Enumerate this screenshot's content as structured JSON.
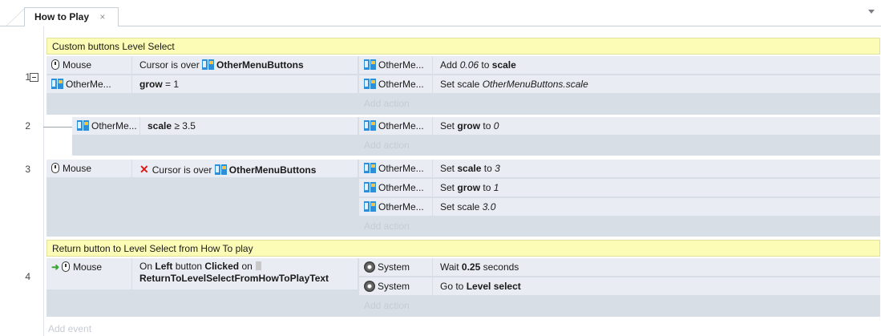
{
  "tab": {
    "title": "How to Play",
    "close": "×"
  },
  "groups": [
    {
      "title": "Custom buttons Level Select"
    },
    {
      "title": "Return button to Level Select from How To play"
    }
  ],
  "events": [
    {
      "number": "1",
      "conditions": [
        {
          "object": "Mouse",
          "text": "Cursor is over",
          "target": "OtherMenuButtons"
        },
        {
          "object": "OtherMe...",
          "param": "grow",
          "text": "= 1"
        }
      ],
      "actions": [
        {
          "object": "OtherMe...",
          "pre": "Add",
          "val": "0.06",
          "mid": "to",
          "param": "scale"
        },
        {
          "object": "OtherMe...",
          "pre": "Set scale",
          "val": "OtherMenuButtons.scale"
        }
      ],
      "add_action": "Add action"
    },
    {
      "number": "2",
      "conditions": [
        {
          "object": "OtherMe...",
          "param": "scale",
          "text": "≥ 3.5"
        }
      ],
      "actions": [
        {
          "object": "OtherMe...",
          "pre": "Set",
          "param": "grow",
          "mid": "to",
          "val": "0"
        }
      ],
      "add_action": "Add action"
    },
    {
      "number": "3",
      "conditions": [
        {
          "object": "Mouse",
          "text": "Cursor is over",
          "target": "OtherMenuButtons"
        }
      ],
      "actions": [
        {
          "object": "OtherMe...",
          "pre": "Set",
          "param": "scale",
          "mid": "to",
          "val": "3"
        },
        {
          "object": "OtherMe...",
          "pre": "Set",
          "param": "grow",
          "mid": "to",
          "val": "1"
        },
        {
          "object": "OtherMe...",
          "pre": "Set scale",
          "val": "3.0"
        }
      ],
      "add_action": "Add action"
    },
    {
      "number": "4",
      "conditions": [
        {
          "object": "Mouse",
          "pre": "On",
          "b1": "Left",
          "mid": "button",
          "b2": "Clicked",
          "post": "on",
          "target": "ReturnToLevelSelectFromHowToPlayText"
        }
      ],
      "actions": [
        {
          "object": "System",
          "pre": "Wait",
          "val": "0.25",
          "post": "seconds"
        },
        {
          "object": "System",
          "pre": "Go to",
          "param": "Level select"
        }
      ],
      "add_action": "Add action"
    }
  ],
  "add_event": "Add event",
  "icons": {
    "mouse": "mouse-icon",
    "sprite": "sprite-icon",
    "system": "gear-icon",
    "invert": "x-icon",
    "trigger": "green-arrow-icon",
    "text_object": "text-object-icon",
    "collapse": "collapse-minus-icon"
  },
  "colors": {
    "group_header": "#fcfcb6",
    "event_bg": "#d8dee6",
    "row_bg": "#e9edf3",
    "invert_x": "#d91a1a",
    "trigger_arrow": "#3aa636"
  }
}
